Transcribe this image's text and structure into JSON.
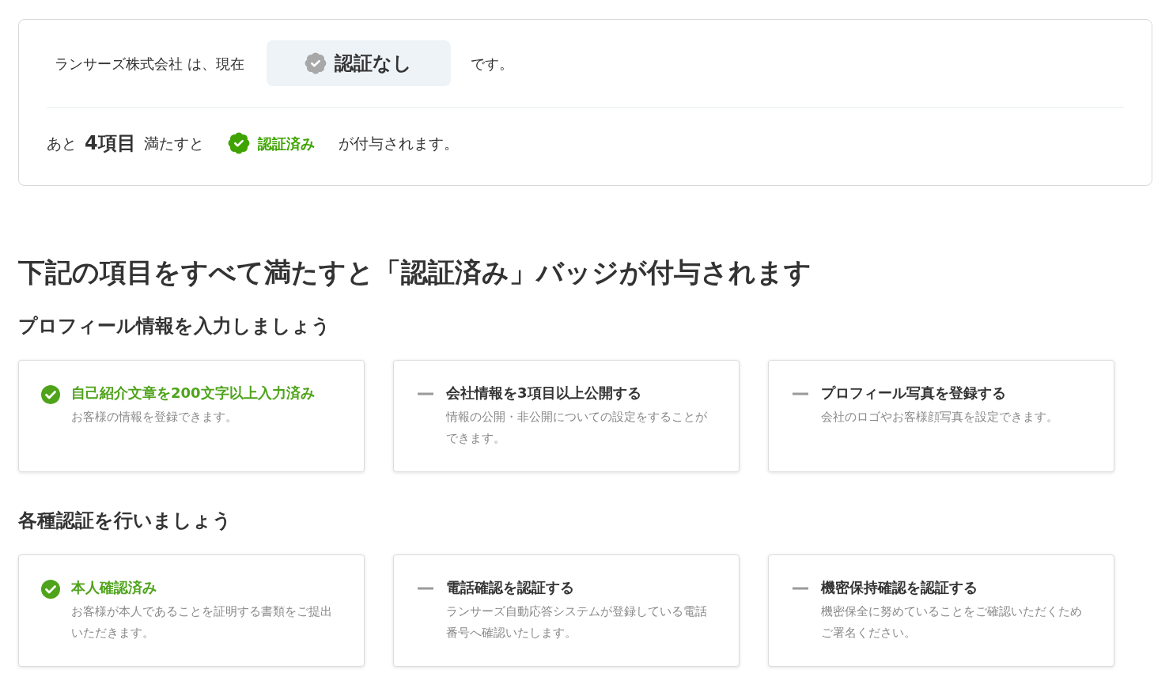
{
  "status": {
    "text": "ランサーズ株式会社 は、現在",
    "badge": {
      "label": "認証なし",
      "verified": false
    },
    "suffix": "です。"
  },
  "remaining": {
    "prefix": "あと",
    "count": "4項目",
    "middle": "満たすと",
    "badge": {
      "label": "認証済み",
      "verified": true
    },
    "suffix": "が付与されます。"
  },
  "heading": "下記の項目をすべて満たすと「認証済み」バッジが付与されます",
  "sections": [
    {
      "title": "プロフィール情報を入力しましょう",
      "items": [
        {
          "title": "自己紹介文章を200文字以上入力済み",
          "description": "お客様の情報を登録できます。",
          "done": true
        },
        {
          "title": "会社情報を3項目以上公開する",
          "description": "情報の公開・非公開についての設定をすることができます。",
          "done": false
        },
        {
          "title": "プロフィール写真を登録する",
          "description": "会社のロゴやお客様顔写真を設定できます。",
          "done": false
        }
      ]
    },
    {
      "title": "各種認証を行いましょう",
      "items": [
        {
          "title": "本人確認済み",
          "description": "お客様が本人であることを証明する書類をご提出いただきます。",
          "done": true
        },
        {
          "title": "電話確認を認証する",
          "description": "ランサーズ自動応答システムが登録している電話番号へ確認いたします。",
          "done": false
        },
        {
          "title": "機密保持確認を認証する",
          "description": "機密保全に努めていることをご確認いただくためご署名ください。",
          "done": false
        }
      ]
    }
  ]
}
